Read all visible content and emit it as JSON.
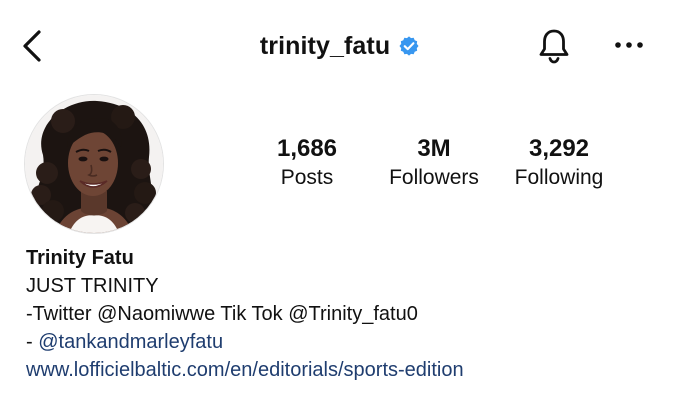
{
  "header": {
    "username": "trinity_fatu",
    "back_icon": "chevron-left-icon",
    "verified_icon": "verified-badge-icon",
    "notification_icon": "bell-icon",
    "more_icon": "more-horizontal-icon",
    "verified_color": "#3897f0"
  },
  "profile": {
    "avatar": "profile-photo",
    "stats": {
      "posts": {
        "value": "1,686",
        "label": "Posts"
      },
      "followers": {
        "value": "3M",
        "label": "Followers"
      },
      "following": {
        "value": "3,292",
        "label": "Following"
      }
    }
  },
  "bio": {
    "display_name": "Trinity Fatu",
    "line1": "JUST TRINITY",
    "line2": "-Twitter @Naomiwwe Tik Tok @Trinity_fatu0",
    "line3_prefix": "- ",
    "line3_mention": "@tankandmarleyfatu",
    "website": "www.lofficielbaltic.com/en/editorials/sports-edition",
    "link_color": "#1f3d6f"
  }
}
